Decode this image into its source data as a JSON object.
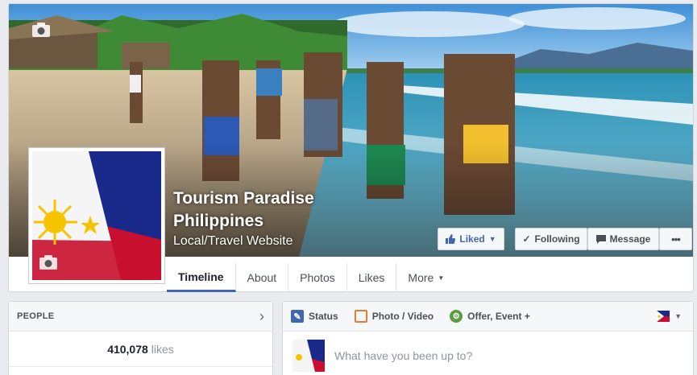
{
  "page": {
    "name": "Tourism Paradise Philippines",
    "category": "Local/Travel Website"
  },
  "actions": {
    "liked": "Liked",
    "following": "Following",
    "message": "Message",
    "more": "•••"
  },
  "tabs": [
    {
      "label": "Timeline"
    },
    {
      "label": "About"
    },
    {
      "label": "Photos"
    },
    {
      "label": "Likes"
    },
    {
      "label": "More"
    }
  ],
  "people": {
    "title": "PEOPLE",
    "likes_count": "410,078",
    "likes_label": "likes"
  },
  "composer": {
    "status": "Status",
    "photo_video": "Photo / Video",
    "offer_event": "Offer, Event +",
    "placeholder": "What have you been up to?"
  },
  "colors": {
    "accent": "#4267b2",
    "flag_blue": "#1a2a8a",
    "flag_red": "#c8102e",
    "flag_yellow": "#f6c300"
  },
  "icons": [
    "camera-icon",
    "thumbs-up-icon",
    "chevron-down-icon",
    "check-icon",
    "message-icon",
    "more-icon",
    "chevron-right-icon",
    "pencil-icon",
    "photo-icon",
    "offer-icon",
    "flag-icon"
  ]
}
